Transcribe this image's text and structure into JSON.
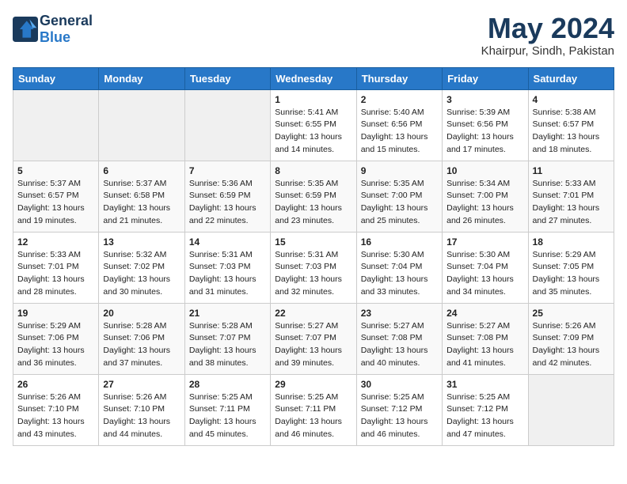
{
  "logo": {
    "general": "General",
    "blue": "Blue"
  },
  "title": "May 2024",
  "location": "Khairpur, Sindh, Pakistan",
  "days": [
    "Sunday",
    "Monday",
    "Tuesday",
    "Wednesday",
    "Thursday",
    "Friday",
    "Saturday"
  ],
  "weeks": [
    [
      {
        "date": "",
        "sunrise": "",
        "sunset": "",
        "daylight": ""
      },
      {
        "date": "",
        "sunrise": "",
        "sunset": "",
        "daylight": ""
      },
      {
        "date": "",
        "sunrise": "",
        "sunset": "",
        "daylight": ""
      },
      {
        "date": "1",
        "sunrise": "Sunrise: 5:41 AM",
        "sunset": "Sunset: 6:55 PM",
        "daylight": "Daylight: 13 hours and 14 minutes."
      },
      {
        "date": "2",
        "sunrise": "Sunrise: 5:40 AM",
        "sunset": "Sunset: 6:56 PM",
        "daylight": "Daylight: 13 hours and 15 minutes."
      },
      {
        "date": "3",
        "sunrise": "Sunrise: 5:39 AM",
        "sunset": "Sunset: 6:56 PM",
        "daylight": "Daylight: 13 hours and 17 minutes."
      },
      {
        "date": "4",
        "sunrise": "Sunrise: 5:38 AM",
        "sunset": "Sunset: 6:57 PM",
        "daylight": "Daylight: 13 hours and 18 minutes."
      }
    ],
    [
      {
        "date": "5",
        "sunrise": "Sunrise: 5:37 AM",
        "sunset": "Sunset: 6:57 PM",
        "daylight": "Daylight: 13 hours and 19 minutes."
      },
      {
        "date": "6",
        "sunrise": "Sunrise: 5:37 AM",
        "sunset": "Sunset: 6:58 PM",
        "daylight": "Daylight: 13 hours and 21 minutes."
      },
      {
        "date": "7",
        "sunrise": "Sunrise: 5:36 AM",
        "sunset": "Sunset: 6:59 PM",
        "daylight": "Daylight: 13 hours and 22 minutes."
      },
      {
        "date": "8",
        "sunrise": "Sunrise: 5:35 AM",
        "sunset": "Sunset: 6:59 PM",
        "daylight": "Daylight: 13 hours and 23 minutes."
      },
      {
        "date": "9",
        "sunrise": "Sunrise: 5:35 AM",
        "sunset": "Sunset: 7:00 PM",
        "daylight": "Daylight: 13 hours and 25 minutes."
      },
      {
        "date": "10",
        "sunrise": "Sunrise: 5:34 AM",
        "sunset": "Sunset: 7:00 PM",
        "daylight": "Daylight: 13 hours and 26 minutes."
      },
      {
        "date": "11",
        "sunrise": "Sunrise: 5:33 AM",
        "sunset": "Sunset: 7:01 PM",
        "daylight": "Daylight: 13 hours and 27 minutes."
      }
    ],
    [
      {
        "date": "12",
        "sunrise": "Sunrise: 5:33 AM",
        "sunset": "Sunset: 7:01 PM",
        "daylight": "Daylight: 13 hours and 28 minutes."
      },
      {
        "date": "13",
        "sunrise": "Sunrise: 5:32 AM",
        "sunset": "Sunset: 7:02 PM",
        "daylight": "Daylight: 13 hours and 30 minutes."
      },
      {
        "date": "14",
        "sunrise": "Sunrise: 5:31 AM",
        "sunset": "Sunset: 7:03 PM",
        "daylight": "Daylight: 13 hours and 31 minutes."
      },
      {
        "date": "15",
        "sunrise": "Sunrise: 5:31 AM",
        "sunset": "Sunset: 7:03 PM",
        "daylight": "Daylight: 13 hours and 32 minutes."
      },
      {
        "date": "16",
        "sunrise": "Sunrise: 5:30 AM",
        "sunset": "Sunset: 7:04 PM",
        "daylight": "Daylight: 13 hours and 33 minutes."
      },
      {
        "date": "17",
        "sunrise": "Sunrise: 5:30 AM",
        "sunset": "Sunset: 7:04 PM",
        "daylight": "Daylight: 13 hours and 34 minutes."
      },
      {
        "date": "18",
        "sunrise": "Sunrise: 5:29 AM",
        "sunset": "Sunset: 7:05 PM",
        "daylight": "Daylight: 13 hours and 35 minutes."
      }
    ],
    [
      {
        "date": "19",
        "sunrise": "Sunrise: 5:29 AM",
        "sunset": "Sunset: 7:06 PM",
        "daylight": "Daylight: 13 hours and 36 minutes."
      },
      {
        "date": "20",
        "sunrise": "Sunrise: 5:28 AM",
        "sunset": "Sunset: 7:06 PM",
        "daylight": "Daylight: 13 hours and 37 minutes."
      },
      {
        "date": "21",
        "sunrise": "Sunrise: 5:28 AM",
        "sunset": "Sunset: 7:07 PM",
        "daylight": "Daylight: 13 hours and 38 minutes."
      },
      {
        "date": "22",
        "sunrise": "Sunrise: 5:27 AM",
        "sunset": "Sunset: 7:07 PM",
        "daylight": "Daylight: 13 hours and 39 minutes."
      },
      {
        "date": "23",
        "sunrise": "Sunrise: 5:27 AM",
        "sunset": "Sunset: 7:08 PM",
        "daylight": "Daylight: 13 hours and 40 minutes."
      },
      {
        "date": "24",
        "sunrise": "Sunrise: 5:27 AM",
        "sunset": "Sunset: 7:08 PM",
        "daylight": "Daylight: 13 hours and 41 minutes."
      },
      {
        "date": "25",
        "sunrise": "Sunrise: 5:26 AM",
        "sunset": "Sunset: 7:09 PM",
        "daylight": "Daylight: 13 hours and 42 minutes."
      }
    ],
    [
      {
        "date": "26",
        "sunrise": "Sunrise: 5:26 AM",
        "sunset": "Sunset: 7:10 PM",
        "daylight": "Daylight: 13 hours and 43 minutes."
      },
      {
        "date": "27",
        "sunrise": "Sunrise: 5:26 AM",
        "sunset": "Sunset: 7:10 PM",
        "daylight": "Daylight: 13 hours and 44 minutes."
      },
      {
        "date": "28",
        "sunrise": "Sunrise: 5:25 AM",
        "sunset": "Sunset: 7:11 PM",
        "daylight": "Daylight: 13 hours and 45 minutes."
      },
      {
        "date": "29",
        "sunrise": "Sunrise: 5:25 AM",
        "sunset": "Sunset: 7:11 PM",
        "daylight": "Daylight: 13 hours and 46 minutes."
      },
      {
        "date": "30",
        "sunrise": "Sunrise: 5:25 AM",
        "sunset": "Sunset: 7:12 PM",
        "daylight": "Daylight: 13 hours and 46 minutes."
      },
      {
        "date": "31",
        "sunrise": "Sunrise: 5:25 AM",
        "sunset": "Sunset: 7:12 PM",
        "daylight": "Daylight: 13 hours and 47 minutes."
      },
      {
        "date": "",
        "sunrise": "",
        "sunset": "",
        "daylight": ""
      }
    ]
  ]
}
